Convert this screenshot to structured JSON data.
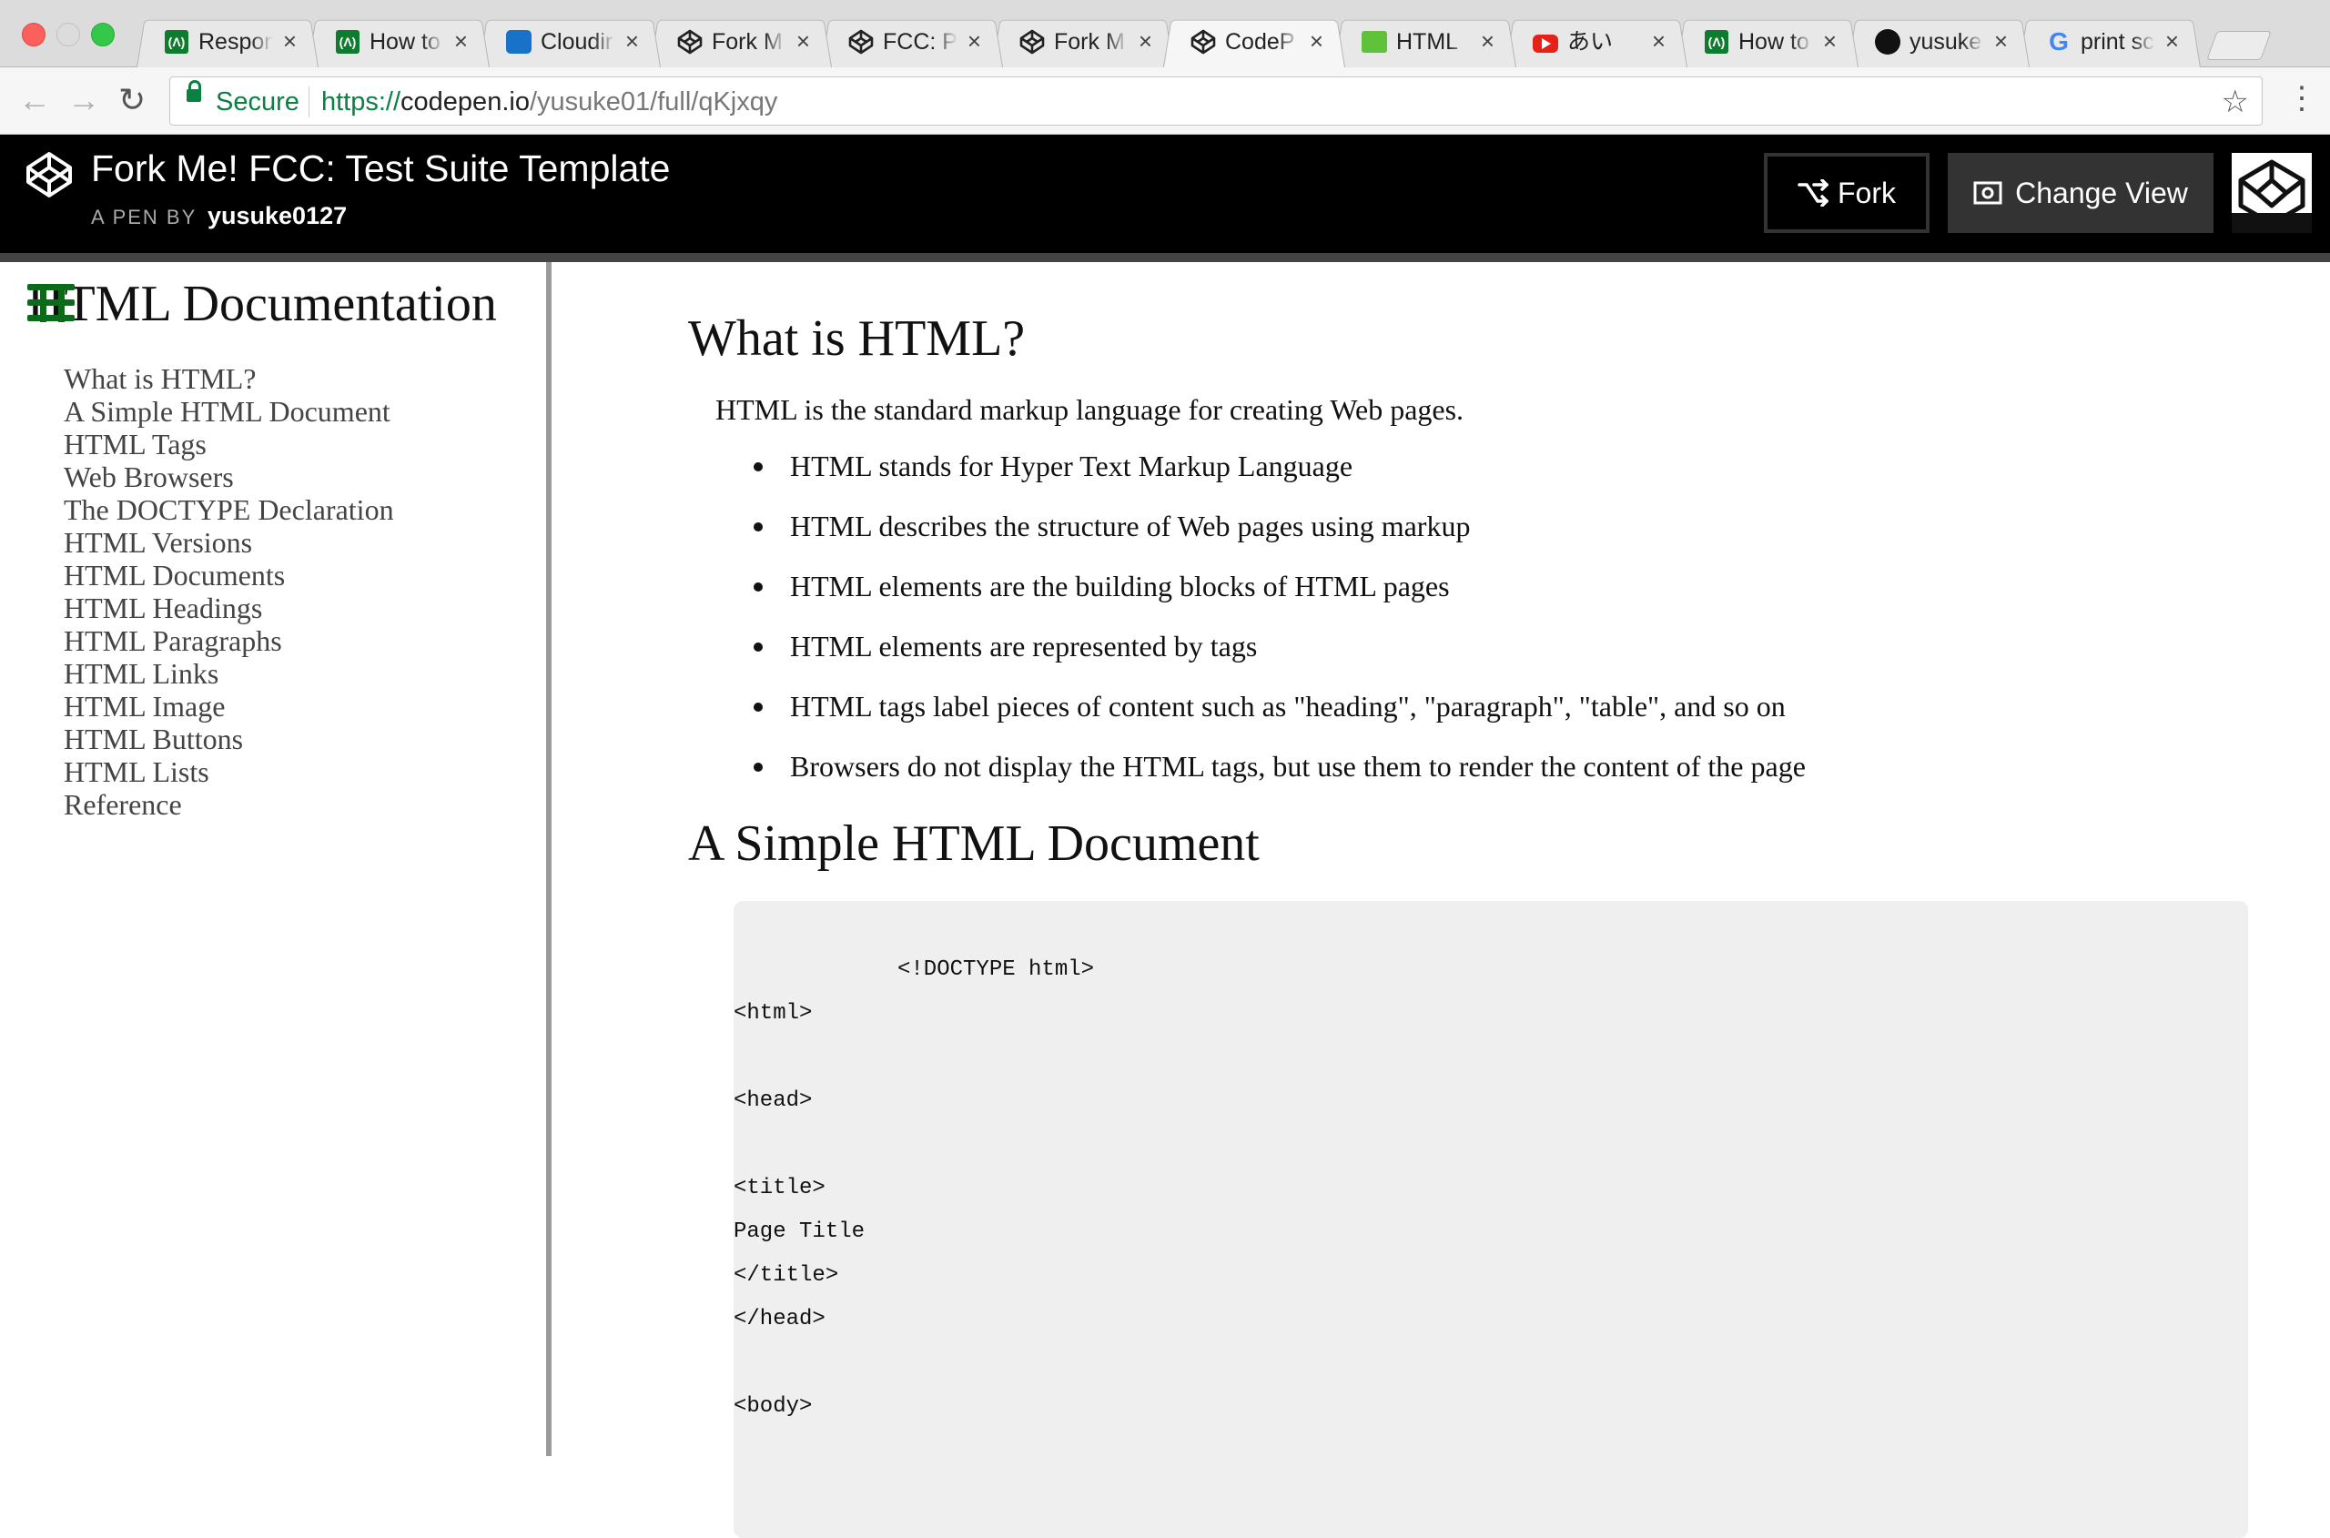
{
  "tabs": [
    {
      "title": "Respon",
      "icon": "freecodecamp-icon"
    },
    {
      "title": "How to",
      "icon": "freecodecamp-icon"
    },
    {
      "title": "Cloudir",
      "icon": "cloudinary-icon"
    },
    {
      "title": "Fork M",
      "icon": "codepen-icon"
    },
    {
      "title": "FCC: P",
      "icon": "codepen-icon"
    },
    {
      "title": "Fork M",
      "icon": "codepen-icon"
    },
    {
      "title": "CodeP",
      "icon": "codepen-icon",
      "active": true
    },
    {
      "title": "HTML",
      "icon": "w3schools-icon"
    },
    {
      "title": "あい",
      "icon": "youtube-icon"
    },
    {
      "title": "How to",
      "icon": "freecodecamp-icon"
    },
    {
      "title": "yusuke",
      "icon": "github-icon"
    },
    {
      "title": "print sc",
      "icon": "google-icon"
    }
  ],
  "address_bar": {
    "secure_label": "Secure",
    "url_scheme": "https://",
    "url_host": "codepen.io",
    "url_path": "/yusuke01/full/qKjxqy"
  },
  "codepen": {
    "title": "Fork Me! FCC: Test Suite Template",
    "byline_prefix": "A PEN BY",
    "author": "yusuke0127",
    "fork_label": "Fork",
    "change_view_label": "Change View"
  },
  "sidebar": {
    "title": "HTML Documentation",
    "items": [
      "What is HTML?",
      "A Simple HTML Document",
      "HTML Tags",
      "Web Browsers",
      "The DOCTYPE Declaration",
      "HTML Versions",
      "HTML Documents",
      "HTML Headings",
      "HTML Paragraphs",
      "HTML Links",
      "HTML Image",
      "HTML Buttons",
      "HTML Lists",
      "Reference"
    ]
  },
  "main": {
    "section1_title": "What is HTML?",
    "intro": "HTML is the standard markup language for creating Web pages.",
    "bullets": [
      "HTML stands for Hyper Text Markup Language",
      "HTML describes the structure of Web pages using markup",
      "HTML elements are the building blocks of HTML pages",
      "HTML elements are represented by tags",
      "HTML tags label pieces of content such as \"heading\", \"paragraph\", \"table\", and so on",
      "Browsers do not display the HTML tags, but use them to render the content of the page"
    ],
    "section2_title": "A Simple HTML Document",
    "code_lines": [
      "<!DOCTYPE html>",
      "<html>",
      "<head>",
      "<title>",
      "Page Title",
      "</title>",
      "</head>",
      "<body>"
    ]
  }
}
